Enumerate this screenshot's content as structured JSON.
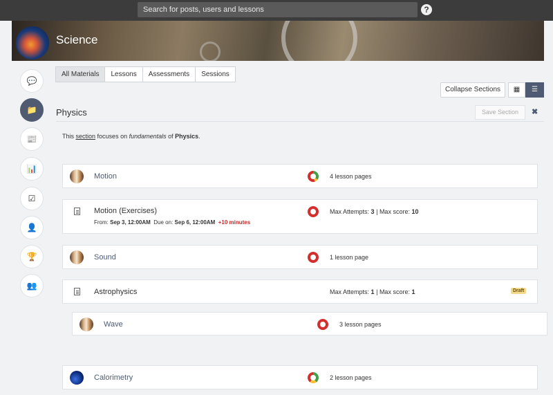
{
  "search": {
    "placeholder": "Search for posts, users and lessons"
  },
  "help": {
    "label": "?"
  },
  "course": {
    "title": "Science"
  },
  "sidebar": {
    "items": [
      {
        "name": "discussion-icon",
        "glyph": "💬"
      },
      {
        "name": "folder-icon",
        "glyph": "📁"
      },
      {
        "name": "newspaper-icon",
        "glyph": "📰"
      },
      {
        "name": "bar-chart-icon",
        "glyph": "📊"
      },
      {
        "name": "checkbox-icon",
        "glyph": "☑"
      },
      {
        "name": "user-icon",
        "glyph": "👤"
      },
      {
        "name": "trophy-icon",
        "glyph": "🏆"
      },
      {
        "name": "users-icon",
        "glyph": "👥"
      }
    ]
  },
  "tabs": [
    "All Materials",
    "Lessons",
    "Assessments",
    "Sessions"
  ],
  "toolbar": {
    "collapse_label": "Collapse Sections",
    "grid_glyph": "▦",
    "list_glyph": "☰"
  },
  "section": {
    "title": "Physics",
    "save_label": "Save Section",
    "close_glyph": "✖",
    "description": {
      "p1": "This ",
      "link": "section",
      "p2": " focuses on ",
      "em": "fundamentals",
      "p3": " of ",
      "strong": "Physics",
      "p4": "."
    }
  },
  "items": [
    {
      "title": "Motion",
      "meta": "4 lesson pages"
    },
    {
      "title": "Motion (Exercises)",
      "from_label": "From:",
      "from": "Sep 3, 12:00AM",
      "due_label": "Due on:",
      "due": "Sep 6, 12:00AM",
      "late": "+10 minutes",
      "attempts_label": "Max Attempts:",
      "attempts": "3",
      "sep": "|",
      "score_label": "Max score:",
      "score": "10"
    },
    {
      "title": "Sound",
      "meta": "1 lesson page"
    },
    {
      "title": "Astrophysics",
      "attempts_label": "Max Attempts:",
      "attempts": "1",
      "sep": "|",
      "score_label": "Max score:",
      "score": "1",
      "badge": "Draft"
    },
    {
      "title": "Wave",
      "meta": "3 lesson pages"
    },
    {
      "title": "Calorimetry",
      "meta": "2 lesson pages"
    }
  ],
  "colors": {
    "accent": "#4e5b73",
    "ring_red": "#d32f2f",
    "ring_green": "#43a047",
    "ring_yellow": "#fbc02d",
    "late": "#c62828",
    "draft_bg": "#f5d98a"
  }
}
